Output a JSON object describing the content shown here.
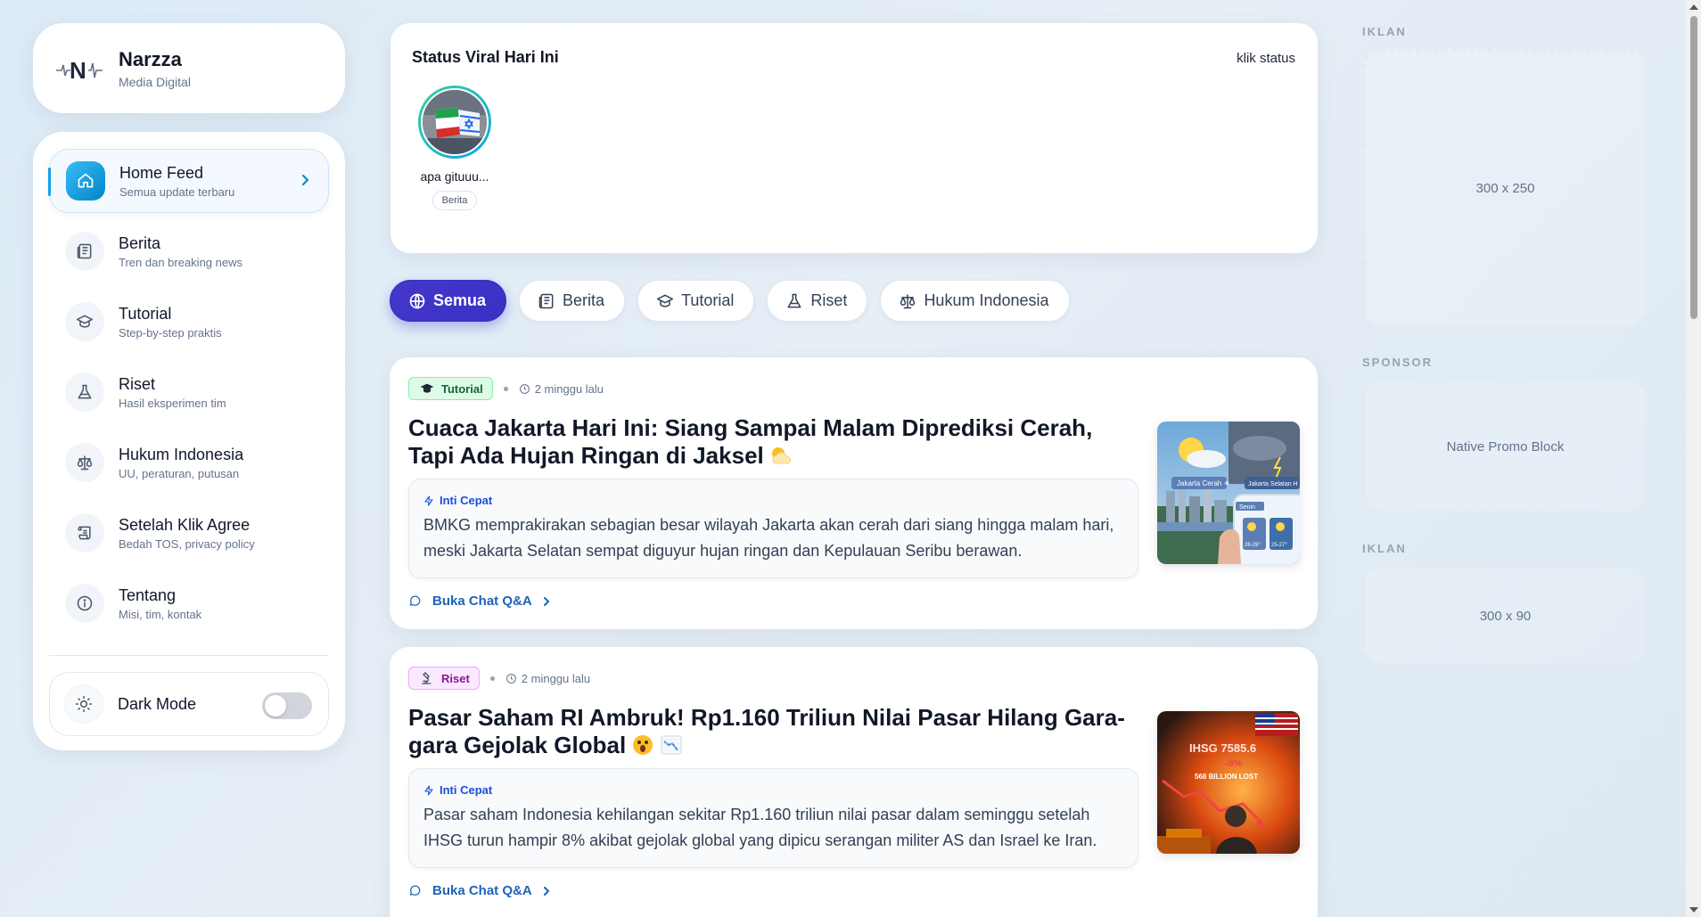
{
  "brand": {
    "name": "Narzza",
    "subtitle": "Media Digital",
    "logo_icon": "n-logo-icon"
  },
  "sidebar": {
    "items": [
      {
        "label": "Home Feed",
        "sub": "Semua update terbaru",
        "icon": "home-icon",
        "active": true
      },
      {
        "label": "Berita",
        "sub": "Tren dan breaking news",
        "icon": "newspaper-icon"
      },
      {
        "label": "Tutorial",
        "sub": "Step-by-step praktis",
        "icon": "graduation-cap-icon"
      },
      {
        "label": "Riset",
        "sub": "Hasil eksperimen tim",
        "icon": "flask-icon"
      },
      {
        "label": "Hukum Indonesia",
        "sub": "UU, peraturan, putusan",
        "icon": "scale-icon"
      },
      {
        "label": "Setelah Klik Agree",
        "sub": "Bedah TOS, privacy policy",
        "icon": "scroll-icon"
      },
      {
        "label": "Tentang",
        "sub": "Misi, tim, kontak",
        "icon": "info-icon"
      }
    ],
    "dark_mode": {
      "label": "Dark Mode",
      "enabled": false,
      "icon": "sun-icon"
    }
  },
  "status": {
    "title": "Status Viral Hari Ini",
    "hint": "klik status",
    "stories": [
      {
        "caption": "apa gituuu...",
        "tag": "Berita"
      }
    ]
  },
  "filters": [
    {
      "label": "Semua",
      "icon": "globe-icon",
      "active": true
    },
    {
      "label": "Berita",
      "icon": "newspaper-icon"
    },
    {
      "label": "Tutorial",
      "icon": "graduation-cap-icon"
    },
    {
      "label": "Riset",
      "icon": "flask-icon"
    },
    {
      "label": "Hukum Indonesia",
      "icon": "scale-icon"
    }
  ],
  "articles": [
    {
      "category": "Tutorial",
      "time": "2 minggu lalu",
      "title": "Cuaca Jakarta Hari Ini: Siang Sampai Malam Diprediksi Cerah, Tapi Ada Hujan Ringan di Jaksel",
      "emoji": "sun-behind-cloud",
      "inti_label": "Inti Cepat",
      "summary": "BMKG memprakirakan sebagian besar wilayah Jakarta akan cerah dari siang hingga malam hari, meski Jakarta Selatan sempat diguyur hujan ringan dan Kepulauan Seribu berawan.",
      "qa_label": "Buka Chat Q&A",
      "thumb_labels": [
        "Jakarta Cerah ☀",
        "Jakarta Selatan H",
        "Senin",
        "28-29°",
        "25-27°"
      ]
    },
    {
      "category": "Riset",
      "time": "2 minggu lalu",
      "title": "Pasar Saham RI Ambruk! Rp1.160 Triliun Nilai Pasar Hilang Gara-gara Gejolak Global",
      "emoji": "shocked-face, chart-decreasing",
      "inti_label": "Inti Cepat",
      "summary": "Pasar saham Indonesia kehilangan sekitar Rp1.160 triliun nilai pasar dalam seminggu setelah IHSG turun hampir 8% akibat gejolak global yang dipicu serangan militer AS dan Israel ke Iran.",
      "qa_label": "Buka Chat Q&A",
      "thumb_labels": [
        "IHSG 7585.6",
        "-8%",
        "568 BILLION LOST"
      ]
    }
  ],
  "ads": [
    {
      "label": "IKLAN",
      "text": "300 x 250"
    },
    {
      "label": "SPONSOR",
      "text": "Native Promo Block"
    },
    {
      "label": "IKLAN",
      "text": "300 x 90"
    }
  ]
}
